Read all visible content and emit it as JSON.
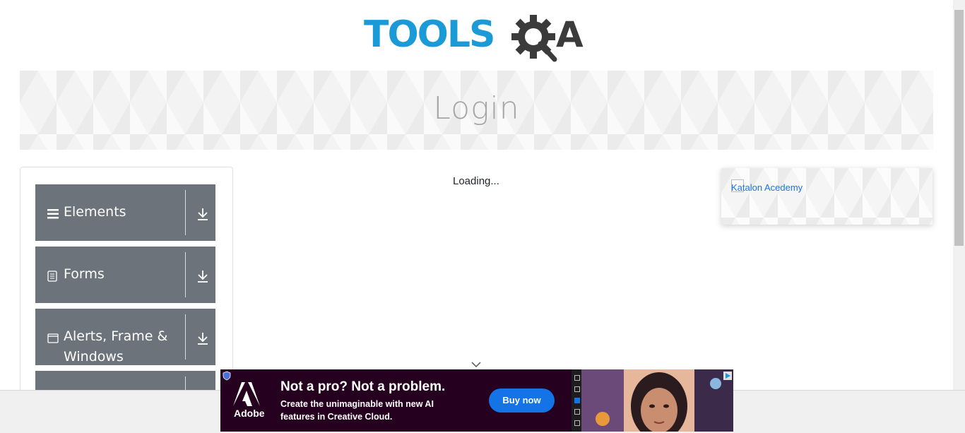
{
  "logo": {
    "text_main": "TOOLS",
    "text_alt": "QA"
  },
  "banner": {
    "title": "Login"
  },
  "sidebar": {
    "groups": [
      {
        "label": "Elements",
        "icon": "hamburger-icon"
      },
      {
        "label": "Forms",
        "icon": "document-icon"
      },
      {
        "label": "Alerts, Frame & Windows",
        "icon": "window-icon"
      }
    ]
  },
  "main": {
    "loading_text": "Loading..."
  },
  "right_ad": {
    "alt_text": "Katalon Acedemy"
  },
  "bottom_ad": {
    "brand": "Adobe",
    "headline": "Not a pro? Not a problem.",
    "body": "Create the unimaginable with new AI features in Creative Cloud.",
    "cta": "Buy now"
  },
  "colors": {
    "brand_blue": "#1a9ad6",
    "dark_gray": "#3b3b3b",
    "sidebar_bg": "#6c737a",
    "ad_bg": "#26001f",
    "cta_bg": "#1473e6"
  }
}
